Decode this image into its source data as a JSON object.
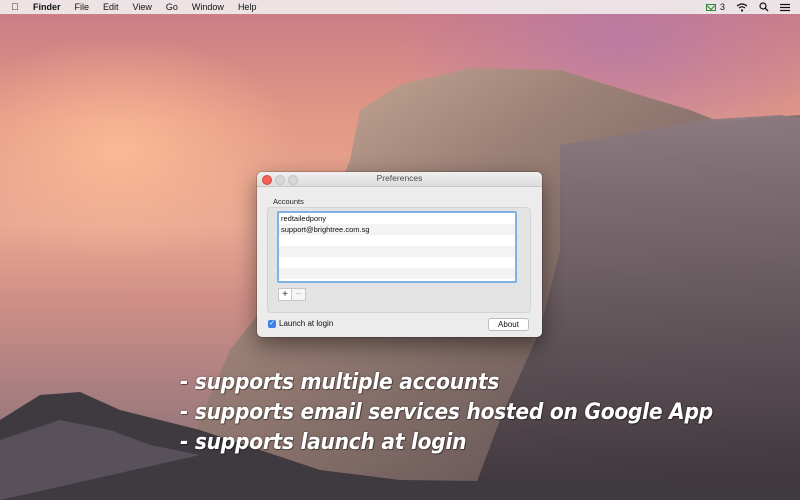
{
  "menubar": {
    "app": "Finder",
    "items": [
      "File",
      "Edit",
      "View",
      "Go",
      "Window",
      "Help"
    ],
    "mail_count": "3",
    "icons": [
      "apple-icon",
      "mail-icon",
      "wifi-icon",
      "search-icon",
      "list-icon"
    ]
  },
  "window": {
    "title": "Preferences",
    "accounts_label": "Accounts",
    "accounts": [
      "redtailedpony",
      "support@brightree.com.sg",
      "",
      "",
      "",
      ""
    ],
    "add_label": "+",
    "remove_label": "−",
    "launch_label": "Launch at login",
    "launch_checked": true,
    "about_label": "About"
  },
  "captions": [
    "- supports multiple accounts",
    "- supports email services hosted on Google App",
    "- supports launch at login"
  ],
  "colors": {
    "menubar_bg": "#f0ecee",
    "listbox_focus": "#7fb1e7",
    "checkbox": "#3b82e8",
    "close_button": "#f45f57"
  }
}
